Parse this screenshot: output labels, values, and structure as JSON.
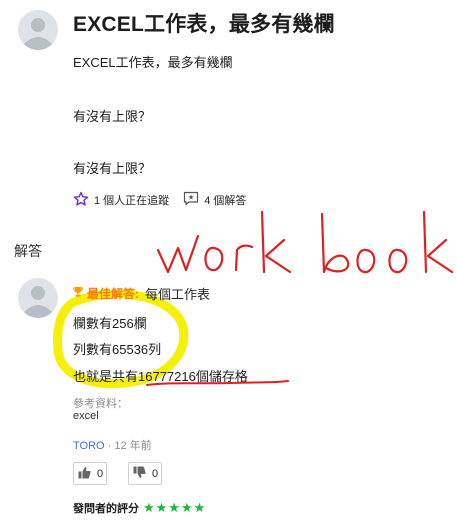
{
  "question": {
    "title": "EXCEL工作表，最多有幾欄",
    "body_lines": [
      "EXCEL工作表，最多有幾欄",
      "有沒有上限？",
      "有沒有上限？"
    ],
    "followers": "1 個人正在追蹤",
    "answers_count": "4 個解答"
  },
  "answers_section": {
    "label": "解答"
  },
  "answer": {
    "best_label": "最佳解答:",
    "lines": [
      "每個工作表",
      "欄數有256欄",
      "列數有65536列",
      "也就是共有16777216個儲存格"
    ],
    "reference_label": "參考資料：",
    "reference_value": "excel",
    "author": "TORO",
    "separator": "·",
    "time": "12 年前",
    "upvotes": "0",
    "downvotes": "0",
    "rating_label": "發問者的評分",
    "stars": "★★★★★"
  },
  "handwriting": {
    "text": "workbook",
    "color": "#e02020"
  },
  "colors": {
    "highlight": "#f5f00a",
    "accent": "#ff7a00",
    "link": "#3b73d6",
    "stars": "#18b83a"
  },
  "icons": [
    "user-avatar-icon",
    "star-outline-icon",
    "answer-bubble-icon",
    "trophy-icon",
    "thumbs-up-icon",
    "thumbs-down-icon"
  ]
}
